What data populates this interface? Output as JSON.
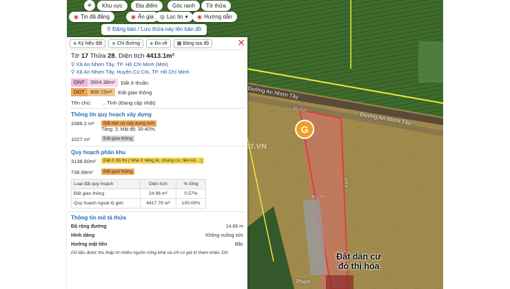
{
  "toolbar": {
    "row1": [
      "Khu vực",
      "Địa điểm",
      "Góc ranh",
      "Tờ thửa"
    ],
    "row2": [
      "Tin đã đăng",
      "Ẩn giá",
      "Lọc tin",
      "Hướng dẫn"
    ],
    "banner": "Đăng bán / Lưu thửa này lên bản đồ"
  },
  "panel": {
    "tabs": [
      "Ký hiệu đất",
      "Chỉ đường",
      "Đo vẽ",
      "Bảng tọa độ"
    ],
    "title_prefix": "Tờ",
    "sheet": "17",
    "plot_label": "Thửa",
    "plot": "28",
    "area_label": "Diện tích",
    "area": "4413.1m²",
    "addresses": [
      "Xã An Nhơn Tây, TP. Hồ Chí Minh (Mới)",
      "Xã An Nhơn Tây, Huyện Củ Chi, TP. Hồ Chí Minh"
    ],
    "land_types": [
      {
        "code": "ONT",
        "area": "3504.38m²",
        "desc": "Đất ở thuần"
      },
      {
        "code": "DGT",
        "area": "908.72m²",
        "desc": "Đất giao thông"
      }
    ],
    "owner_label": "Tên chủ:",
    "owner_value": ".. Tỉnh (Đang cập nhật)",
    "construction": {
      "heading": "Thông tin quy hoạch xây dựng",
      "items": [
        {
          "area": "3386.2 m²",
          "tag": "Đất dân cư xây dựng mới",
          "detail": "Tầng: 3; Mật độ: 30-40%;"
        },
        {
          "area": "1027 m²",
          "tag": "Đất giao thông",
          "detail": ""
        }
      ]
    },
    "zoning": {
      "heading": "Quy hoạch phân khu",
      "items": [
        {
          "area": "3138.60m²",
          "tag": "Đất ở đô thị ( Nhà ở riêng lẻ, chung cư, liền kề... )"
        },
        {
          "area": "736.99m²",
          "tag": "Đất giao thông"
        }
      ],
      "table_headers": [
        "Loại đất quy hoạch",
        "Diện tích",
        "% tổng"
      ],
      "table_rows": [
        [
          "Đất giao thông",
          "24.98 m²",
          "0.57%"
        ],
        [
          "Quy hoạch ngoài lộ giới",
          "4417.79 m²",
          "100.00%"
        ]
      ]
    },
    "description": {
      "heading": "Thông tin mô tả thửa",
      "rows": [
        {
          "label": "Độ rộng đường",
          "value": "14.66 m"
        },
        {
          "label": "Hình dáng",
          "value": "Không vuông vức"
        },
        {
          "label": "Hướng mặt tiền",
          "value": "Bắc"
        }
      ],
      "footnote": "Dữ liệu được thu thập từ nhiều nguồn công khai và chỉ có giá trị tham khảo. Dữ"
    }
  },
  "map": {
    "road1": "Đường An Nhơn Tây",
    "road2": "Đường An Nhơn Tây",
    "road3": "Phạm",
    "watermark": "GUIDEDNHADAT.VN",
    "overlay_line1": "Đất dân cư",
    "overlay_line2": "đô thị hóa",
    "pin_letter": "G",
    "edge_label_top": "42.01m",
    "edge_label_right": "153.9",
    "edge_label_mid": "40.17m"
  },
  "colors": {
    "ont": "#f2b7e2",
    "dgt": "#f0a64f",
    "heading": "#2a6cb3",
    "plot_outline": "#e33d3d",
    "zone_border": "#f2ea3a"
  }
}
